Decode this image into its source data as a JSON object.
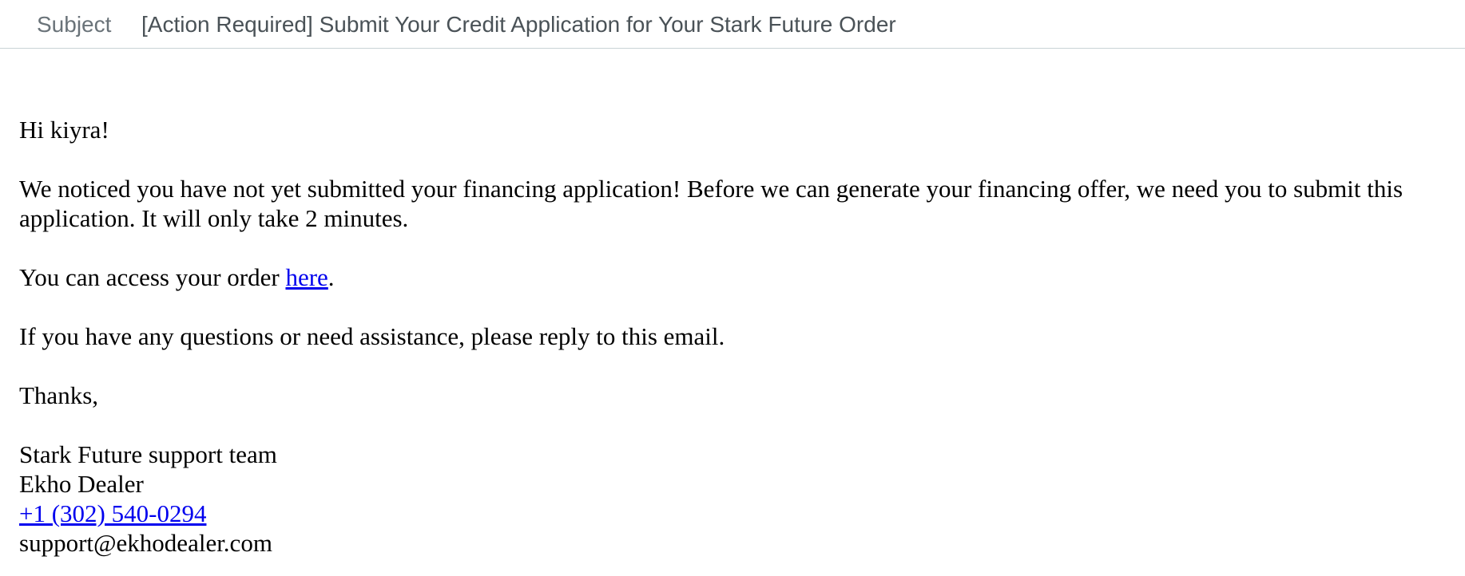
{
  "subject": {
    "label": "Subject",
    "text": "[Action Required] Submit Your Credit Application for Your Stark Future Order"
  },
  "email": {
    "greeting": "Hi kiyra!",
    "paragraph1": "We noticed you have not yet submitted your financing application! Before we can generate your financing offer, we need you to submit this application. It will only take 2 minutes.",
    "order_prefix": "You can access your order ",
    "order_link": "here",
    "order_suffix": ".",
    "help": "If you have any questions or need assistance, please reply to this email.",
    "thanks": "Thanks,",
    "signature": {
      "team": "Stark Future support team",
      "dealer": "Ekho Dealer",
      "phone": "+1 (302) 540-0294",
      "email": "support@ekhodealer.com"
    }
  },
  "colors": {
    "link": "#0000ee",
    "subject_text": "#4a5257",
    "divider": "#c9d3d6"
  }
}
